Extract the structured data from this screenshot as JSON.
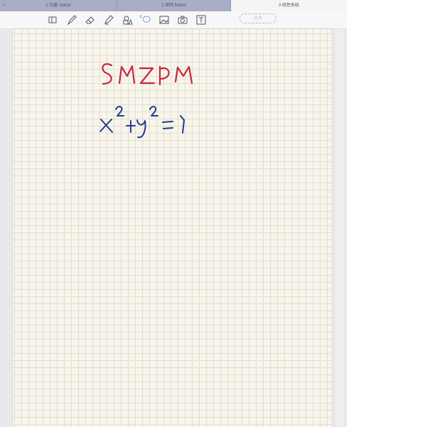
{
  "tabs": [
    {
      "label": "1 向量 Vektor",
      "close": "×",
      "active": false
    },
    {
      "label": "2 矩阵 Matrix",
      "close": "",
      "active": false
    },
    {
      "label": "3 线性系统",
      "close": "",
      "active": true
    }
  ],
  "toolbar": {
    "tools": [
      "thumbnails-icon",
      "pen-icon",
      "eraser-icon",
      "highlighter-icon",
      "shapes-icon",
      "lasso-icon",
      "image-icon",
      "camera-icon",
      "text-icon"
    ],
    "pill_text": "选择"
  },
  "handwriting": {
    "line1": "SMZDM",
    "line2": "x² + y² = 1",
    "colors": {
      "red": "#c8263a",
      "blue": "#1f3c8f"
    }
  }
}
